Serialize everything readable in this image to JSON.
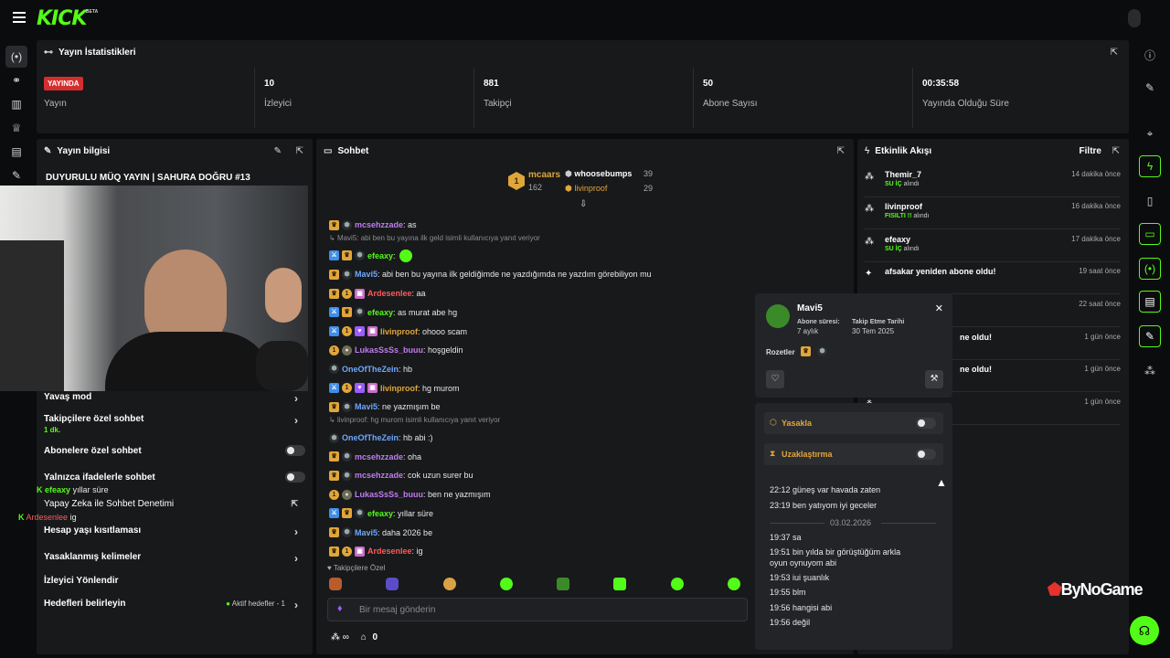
{
  "brand": {
    "logo": "KICK",
    "beta": "BETA"
  },
  "colors": {
    "accent": "#53fc18",
    "live": "#d32f2f",
    "panel": "#18191b"
  },
  "stats": {
    "title": "Yayın İstatistikleri",
    "live_badge": "YAYINDA",
    "items": [
      {
        "value": "",
        "label": "Yayın"
      },
      {
        "value": "10",
        "label": "İzleyici"
      },
      {
        "value": "881",
        "label": "Takipçi"
      },
      {
        "value": "50",
        "label": "Abone Sayısı"
      },
      {
        "value": "00:35:58",
        "label": "Yayında Olduğu Süre"
      }
    ]
  },
  "stream_info": {
    "title": "Yayın bilgisi",
    "stream_title": "DUYURULU MÜQ YAYIN | SAHURA DOĞRU #13",
    "settings": [
      {
        "label": "Yavaş mod",
        "control": "chevron"
      },
      {
        "label": "Takipçilere özel sohbet",
        "sub": "1 dk.",
        "control": "chevron"
      },
      {
        "label": "Abonelere özel sohbet",
        "control": "toggle"
      },
      {
        "label": "Yalnızca ifadelerle sohbet",
        "control": "toggle"
      },
      {
        "label": "Hesap yaşı kısıtlaması",
        "control": "chevron"
      },
      {
        "label": "Yasaklanmış kelimeler",
        "control": "chevron"
      },
      {
        "label": "İzleyici Yönlendir",
        "control": "none"
      },
      {
        "label": "Hedefleri belirleyin",
        "extra": "Aktif hedefler - 1",
        "control": "chevron"
      }
    ],
    "overlay_chat": [
      {
        "user": "efeaxy",
        "text": "yıllar süre"
      },
      {
        "user": "",
        "text": "Yapay Zeka ile Sohbet Denetimi"
      },
      {
        "user": "Ardesenlee",
        "text": "ig"
      }
    ]
  },
  "chat": {
    "title": "Sohbet",
    "leaderboard": [
      {
        "rank": "1",
        "name": "mcaars",
        "count": "162"
      },
      {
        "name": "whoosebumps",
        "count": "39"
      },
      {
        "name": "livinproof",
        "count": "29"
      }
    ],
    "messages": [
      {
        "user": "mcsehzzade",
        "color": "#c07cf0",
        "badges": [
          "crown",
          "shield"
        ],
        "text": ": as"
      },
      {
        "reply": "Mavi5: abi ben bu yayına ilk geld isimli kullanıcıya yanıt veriyor"
      },
      {
        "user": "efeaxy",
        "color": "#53fc18",
        "badges": [
          "mod",
          "crown",
          "shield"
        ],
        "text": ":"
      },
      {
        "user": "Mavi5",
        "color": "#6fa8ff",
        "badges": [
          "crown",
          "shield"
        ],
        "text": ": abi ben bu yayına ilk geldiğimde ne yazdığımda ne yazdım görebiliyon mu"
      },
      {
        "user": "Ardesenlee",
        "color": "#ff5a5a",
        "badges": [
          "crown",
          "one",
          "gift"
        ],
        "text": ": aa"
      },
      {
        "user": "efeaxy",
        "color": "#53fc18",
        "badges": [
          "mod",
          "crown",
          "shield"
        ],
        "text": ": as murat abe hg"
      },
      {
        "user": "livinproof",
        "color": "#e0a63a",
        "badges": [
          "mod",
          "one",
          "vip",
          "gift"
        ],
        "text": ": ohooo scam"
      },
      {
        "user": "LukasSsSs_buuu",
        "color": "#c07cf0",
        "badges": [
          "one",
          "grey"
        ],
        "text": ": hoşgeldin"
      },
      {
        "user": "OneOfTheZein",
        "color": "#6fa8ff",
        "badges": [
          "shield"
        ],
        "text": ": hb"
      },
      {
        "user": "livinproof",
        "color": "#e0a63a",
        "badges": [
          "mod",
          "one",
          "vip",
          "gift"
        ],
        "text": ": hg murom"
      },
      {
        "user": "Mavi5",
        "color": "#6fa8ff",
        "badges": [
          "crown",
          "shield"
        ],
        "text": ": ne yazmışım be"
      },
      {
        "reply": "livinproof: hg murom isimli kullanıcıya yanıt veriyor"
      },
      {
        "user": "OneOfTheZein",
        "color": "#6fa8ff",
        "badges": [
          "shield"
        ],
        "text": ": hb abi :)"
      },
      {
        "user": "mcsehzzade",
        "color": "#c07cf0",
        "badges": [
          "crown",
          "shield"
        ],
        "text": ": oha"
      },
      {
        "user": "mcsehzzade",
        "color": "#c07cf0",
        "badges": [
          "crown",
          "shield"
        ],
        "text": ": cok uzun surer bu"
      },
      {
        "user": "LukasSsSs_buuu",
        "color": "#c07cf0",
        "badges": [
          "one",
          "grey"
        ],
        "text": ": ben ne yazmışım"
      },
      {
        "user": "efeaxy",
        "color": "#53fc18",
        "badges": [
          "mod",
          "crown",
          "shield"
        ],
        "text": ": yıllar süre"
      },
      {
        "user": "Mavi5",
        "color": "#6fa8ff",
        "badges": [
          "crown",
          "shield"
        ],
        "text": ": daha 2026 be"
      },
      {
        "user": "Ardesenlee",
        "color": "#ff5a5a",
        "badges": [
          "crown",
          "one",
          "gift"
        ],
        "text": ": ig"
      }
    ],
    "emote_section": "Takipçilere Özel",
    "input_placeholder": "Bir mesaj gönderin",
    "points": "0"
  },
  "activity": {
    "title": "Etkinlik Akışı",
    "filter": "Filtre",
    "events": [
      {
        "name": "Themir_7",
        "highlight": "SU İÇ",
        "sub": "alındı",
        "time": "14 dakika önce"
      },
      {
        "name": "livinproof",
        "highlight": "FISILTI !!",
        "sub": "alındı",
        "time": "16 dakika önce"
      },
      {
        "name": "efeaxy",
        "highlight": "SU İÇ",
        "sub": "alındı",
        "time": "17 dakika önce"
      },
      {
        "name": "afsakar yeniden abone oldu!",
        "highlight": "",
        "sub": "",
        "time": "19 saat önce"
      },
      {
        "name": "",
        "highlight": "",
        "sub": "",
        "time": "22 saat önce"
      },
      {
        "name": "ne oldu!",
        "highlight": "",
        "sub": "",
        "time": "1 gün önce"
      },
      {
        "name": "ne oldu!",
        "highlight": "",
        "sub": "",
        "time": "1 gün önce"
      },
      {
        "name": "",
        "highlight": "",
        "sub": "",
        "time": "1 gün önce"
      }
    ]
  },
  "user_card": {
    "name": "Mavi5",
    "sub_label": "Abone süresi:",
    "sub_value": "7 aylık",
    "follow_label": "Takip Etme Tarihi",
    "follow_value": "30 Tem 2025",
    "badges_label": "Rozetler",
    "ban_label": "Yasakla",
    "timeout_label": "Uzaklaştırma",
    "history": [
      {
        "time": "22:12",
        "text": "güneş var havada zaten"
      },
      {
        "time": "23:19",
        "text": "ben yatıyom iyi geceler"
      },
      {
        "divider": "03.02.2026"
      },
      {
        "time": "19:37",
        "text": "sa"
      },
      {
        "time": "19:51",
        "text": "bin yılda bir görüştüğüm arkla"
      },
      {
        "cont": "oyun oynuyom abi"
      },
      {
        "time": "19:53",
        "text": "iui şuanlık"
      },
      {
        "time": "19:55",
        "text": "blm"
      },
      {
        "time": "19:56",
        "text": "hangisi abi"
      },
      {
        "time": "19:56",
        "text": "değil"
      }
    ]
  },
  "watermark": "ByNoGame"
}
